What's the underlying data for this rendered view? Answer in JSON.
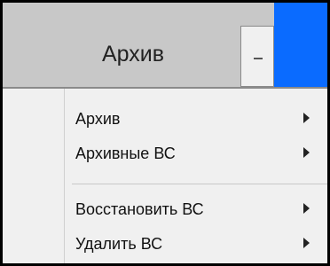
{
  "header": {
    "title": "Архив"
  },
  "menu": {
    "items": [
      {
        "label": "Архив"
      },
      {
        "label": "Архивные ВС"
      },
      {
        "label": "Восстановить ВС"
      },
      {
        "label": "Удалить ВС"
      }
    ]
  },
  "icons": {
    "dropdown": "minus-icon",
    "submenu": "chevron-right-icon"
  },
  "colors": {
    "accent": "#0a6bff",
    "header_bg": "#c8c8c8",
    "menu_bg": "#f0f0f0"
  }
}
